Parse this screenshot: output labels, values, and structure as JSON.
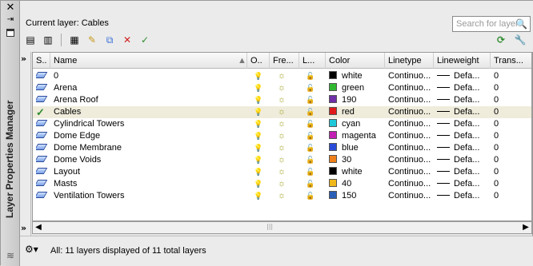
{
  "palette": {
    "vertical_title": "Layer Properties Manager",
    "current_layer_label": "Current layer: Cables",
    "search_placeholder": "Search for layer",
    "status_text": "All: 11 layers displayed of 11 total layers"
  },
  "columns": [
    "S..",
    "Name",
    "O..",
    "Fre...",
    "L...",
    "Color",
    "Linetype",
    "Lineweight",
    "Trans..."
  ],
  "layers": [
    {
      "name": "0",
      "color_name": "white",
      "color_hex": "#000000",
      "linetype": "Continuo...",
      "lineweight": "Defa...",
      "trans": "0",
      "current": false
    },
    {
      "name": "Arena",
      "color_name": "green",
      "color_hex": "#2fb82f",
      "linetype": "Continuo...",
      "lineweight": "Defa...",
      "trans": "0",
      "current": false
    },
    {
      "name": "Arena Roof",
      "color_name": "190",
      "color_hex": "#6e2fa8",
      "linetype": "Continuo...",
      "lineweight": "Defa...",
      "trans": "0",
      "current": false
    },
    {
      "name": "Cables",
      "color_name": "red",
      "color_hex": "#e01a1a",
      "linetype": "Continuo...",
      "lineweight": "Defa...",
      "trans": "0",
      "current": true
    },
    {
      "name": "Cylindrical Towers",
      "color_name": "cyan",
      "color_hex": "#1ec8d8",
      "linetype": "Continuo...",
      "lineweight": "Defa...",
      "trans": "0",
      "current": false
    },
    {
      "name": "Dome Edge",
      "color_name": "magenta",
      "color_hex": "#c21fb5",
      "linetype": "Continuo...",
      "lineweight": "Defa...",
      "trans": "0",
      "current": false
    },
    {
      "name": "Dome Membrane",
      "color_name": "blue",
      "color_hex": "#2a4bd8",
      "linetype": "Continuo...",
      "lineweight": "Defa...",
      "trans": "0",
      "current": false
    },
    {
      "name": "Dome Voids",
      "color_name": "30",
      "color_hex": "#f0801a",
      "linetype": "Continuo...",
      "lineweight": "Defa...",
      "trans": "0",
      "current": false
    },
    {
      "name": "Layout",
      "color_name": "white",
      "color_hex": "#000000",
      "linetype": "Continuo...",
      "lineweight": "Defa...",
      "trans": "0",
      "current": false
    },
    {
      "name": "Masts",
      "color_name": "40",
      "color_hex": "#f0b81a",
      "linetype": "Continuo...",
      "lineweight": "Defa...",
      "trans": "0",
      "current": false
    },
    {
      "name": "Ventilation Towers",
      "color_name": "150",
      "color_hex": "#2a5fb8",
      "linetype": "Continuo...",
      "lineweight": "Defa...",
      "trans": "0",
      "current": false
    }
  ]
}
